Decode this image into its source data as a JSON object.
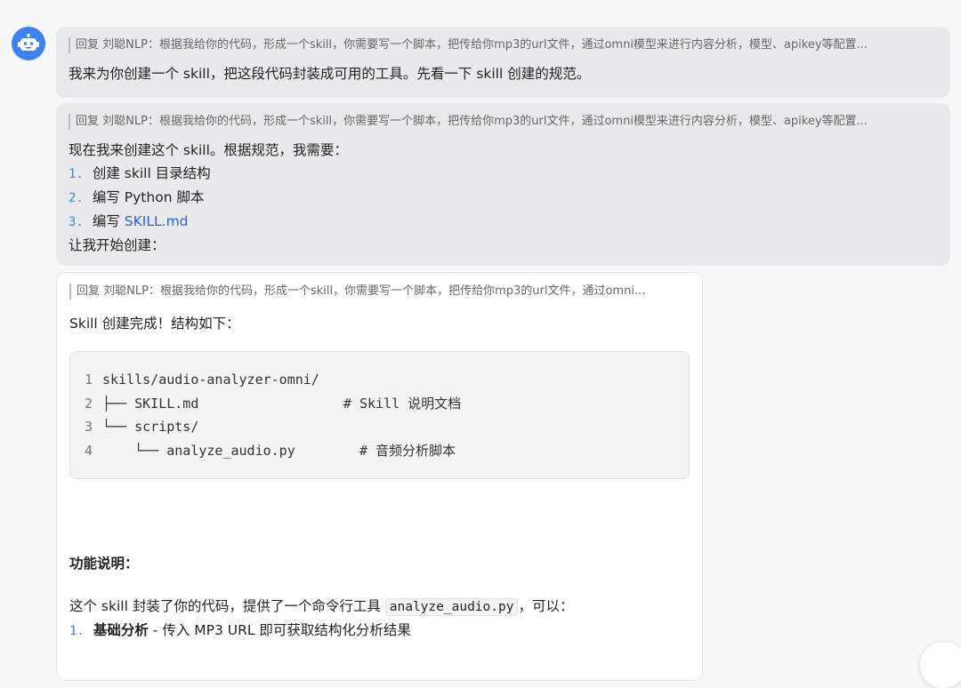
{
  "messages": [
    {
      "quote": "回复 刘聪NLP：根据我给你的代码，形成一个skill，你需要写一个脚本，把传给你mp3的url文件，通过omni模型来进行内容分析，模型、apikey等配置...",
      "text": "我来为你创建一个 skill，把这段代码封装成可用的工具。先看一下 skill 创建的规范。"
    },
    {
      "quote": "回复 刘聪NLP：根据我给你的代码，形成一个skill，你需要写一个脚本，把传给你mp3的url文件，通过omni模型来进行内容分析，模型、apikey等配置...",
      "intro": "现在我来创建这个 skill。根据规范，我需要：",
      "steps": [
        {
          "num": "1.",
          "text": "创建 skill 目录结构"
        },
        {
          "num": "2.",
          "text": "编写 Python 脚本"
        },
        {
          "num": "3.",
          "text": "编写 ",
          "link": "SKILL.md"
        }
      ],
      "outro": "让我开始创建："
    },
    {
      "quote": "回复 刘聪NLP：根据我给你的代码，形成一个skill，你需要写一个脚本，把传给你mp3的url文件，通过omni...",
      "text": "Skill 创建完成！结构如下：",
      "code": [
        {
          "n": "1",
          "text": "skills/audio-analyzer-omni/"
        },
        {
          "n": "2",
          "text": "├── SKILL.md                  # Skill 说明文档"
        },
        {
          "n": "3",
          "text": "└── scripts/"
        },
        {
          "n": "4",
          "text": "    └── analyze_audio.py        # 音频分析脚本"
        }
      ],
      "section_title": "功能说明：",
      "desc_before": "这个 skill 封装了你的代码，提供了一个命令行工具",
      "desc_code": "analyze_audio.py",
      "desc_after": "，可以：",
      "features": [
        {
          "num": "1.",
          "title": "基础分析",
          "text": " - 传入 MP3 URL 即可获取结构化分析结果"
        }
      ]
    }
  ]
}
